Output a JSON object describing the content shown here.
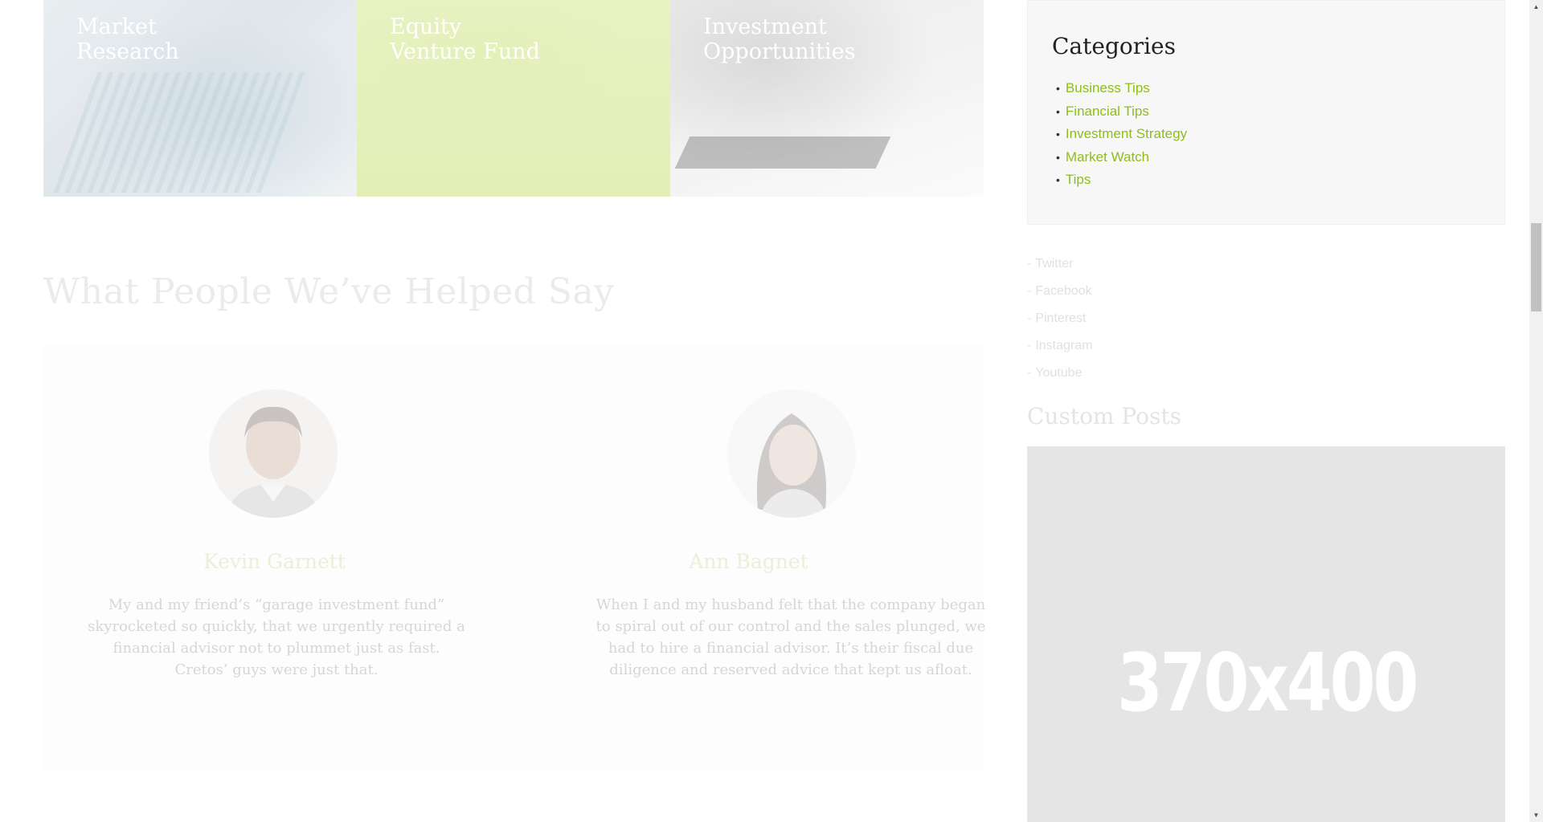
{
  "tiles": [
    {
      "title": "Market\nResearch"
    },
    {
      "title": "Equity\nVenture Fund"
    },
    {
      "title": "Investment\nOpportunities"
    }
  ],
  "testimonials_section": {
    "title": "What People We’ve Helped Say",
    "items": [
      {
        "name": "Kevin Garnett",
        "quote": "My and my friend’s “garage investment fund” skyrocketed so quickly, that we urgently required a financial advisor not to plummet just as fast. Cretos’ guys were just that."
      },
      {
        "name": "Ann Bagnet",
        "quote": "When I and my husband felt that the company began to spiral out of our control and the sales plunged, we had to hire a financial advisor. It’s their fiscal due diligence and reserved advice that kept us afloat."
      }
    ]
  },
  "sidebar": {
    "categories": {
      "title": "Categories",
      "items": [
        "Business Tips",
        "Financial Tips",
        "Investment Strategy",
        "Market Watch",
        "Tips"
      ]
    },
    "social": [
      "Twitter",
      "Facebook",
      "Pinterest",
      "Instagram",
      "Youtube"
    ],
    "custom_posts": {
      "title": "Custom Posts",
      "placeholder_label": "370x400"
    }
  },
  "colors": {
    "accent_green": "#8fbd1a",
    "sidebar_bg": "#f7f7f7",
    "placeholder_bg": "#e5e5e5"
  },
  "icons": {
    "scroll_up": "triangle-up-icon",
    "scroll_down": "triangle-down-icon"
  }
}
